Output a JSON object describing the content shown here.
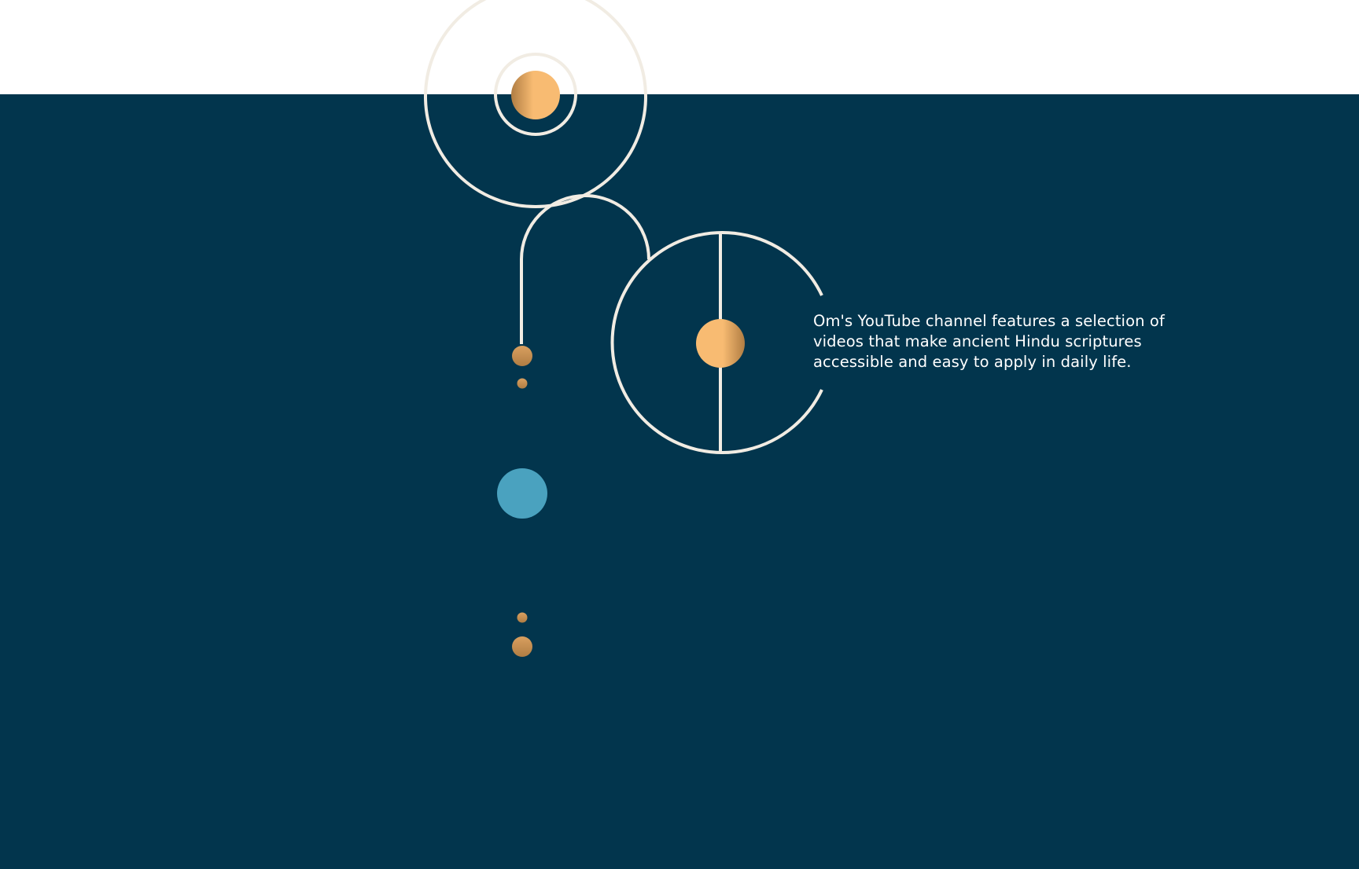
{
  "colors": {
    "navy": "#02354d",
    "white": "#ffffff",
    "cream_line": "#f1ece3",
    "peach": "#f8bb72",
    "bronze": "#b07d43",
    "teal": "#4aa2bf",
    "text": "#ffffff"
  },
  "content": {
    "description": "Om's YouTube channel features a selection of videos that make ancient Hindu scriptures accessible and easy to apply in daily life."
  },
  "icons": {
    "decorative_art": "orbital-line-art"
  }
}
